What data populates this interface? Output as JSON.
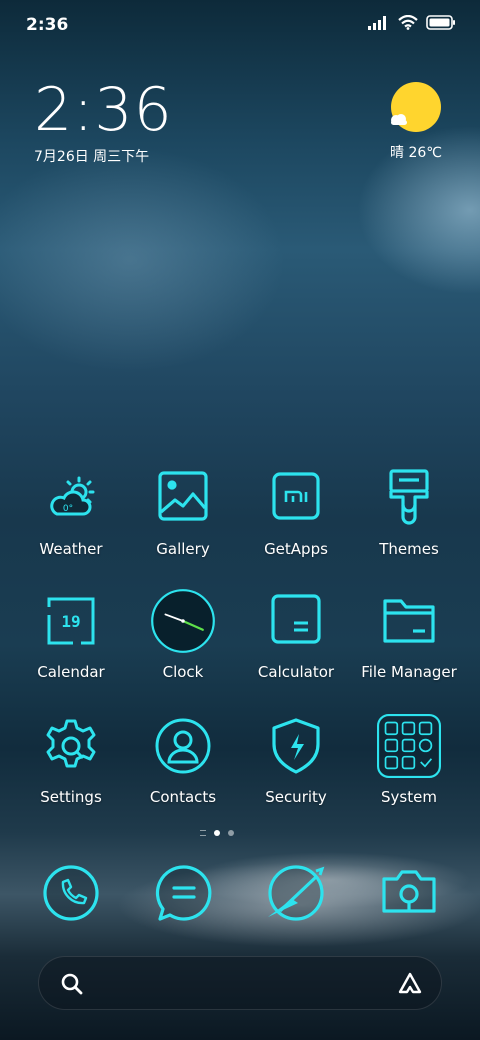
{
  "status_bar": {
    "time": "2:36",
    "icons": [
      "signal-icon",
      "wifi-icon",
      "battery-icon"
    ]
  },
  "clock_widget": {
    "time": "2:36",
    "date": "7月26日 周三下午"
  },
  "weather_widget": {
    "condition_icon": "sunny-icon",
    "text": "晴 26℃"
  },
  "apps": [
    {
      "label": "Weather",
      "icon": "weather-icon"
    },
    {
      "label": "Gallery",
      "icon": "gallery-icon"
    },
    {
      "label": "GetApps",
      "icon": "getapps-icon"
    },
    {
      "label": "Themes",
      "icon": "themes-icon"
    },
    {
      "label": "Calendar",
      "icon": "calendar-icon",
      "icon_text": "19"
    },
    {
      "label": "Clock",
      "icon": "clock-icon"
    },
    {
      "label": "Calculator",
      "icon": "calculator-icon"
    },
    {
      "label": "File Manager",
      "icon": "file-manager-icon"
    },
    {
      "label": "Settings",
      "icon": "settings-icon"
    },
    {
      "label": "Contacts",
      "icon": "contacts-icon"
    },
    {
      "label": "Security",
      "icon": "security-icon"
    },
    {
      "label": "System",
      "icon": "system-folder-icon"
    }
  ],
  "weather_icon_text": "0°",
  "page_indicator": {
    "pages": 2,
    "active_page": 1
  },
  "dock": [
    {
      "icon": "phone-icon"
    },
    {
      "icon": "messages-icon"
    },
    {
      "icon": "browser-icon"
    },
    {
      "icon": "camera-icon"
    }
  ],
  "search_bar": {
    "left_icon": "search-icon",
    "right_icon": "assistant-icon"
  },
  "colors": {
    "accent": "#2de3ee",
    "sun": "#ffd52e"
  }
}
